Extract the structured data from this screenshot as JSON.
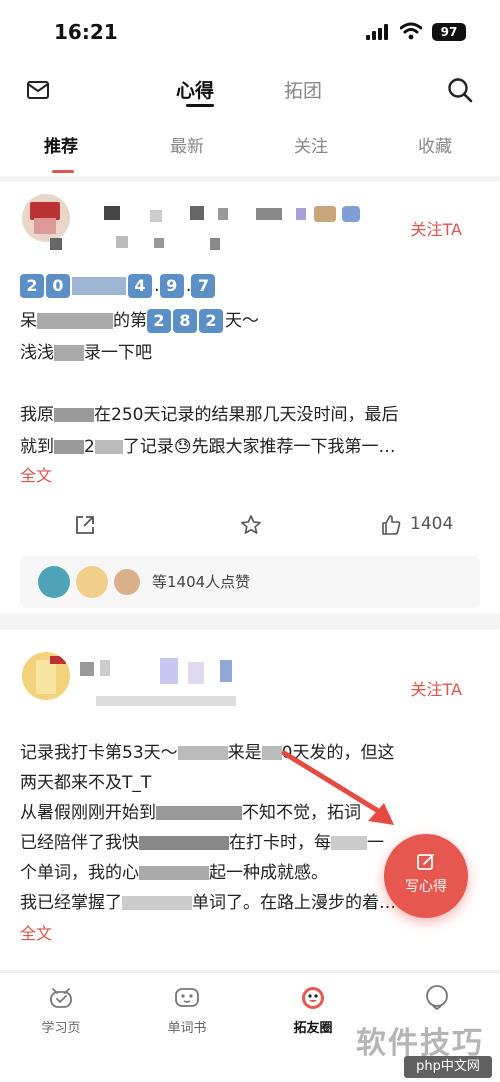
{
  "status_bar": {
    "time": "16:21",
    "battery": "97"
  },
  "header": {
    "tabs": [
      {
        "label": "心得",
        "active": true
      },
      {
        "label": "拓团",
        "active": false
      }
    ]
  },
  "subtabs": [
    {
      "label": "推荐",
      "active": true
    },
    {
      "label": "最新",
      "active": false
    },
    {
      "label": "关注",
      "active": false
    },
    {
      "label": "收藏",
      "active": false
    }
  ],
  "posts": [
    {
      "follow_label": "关注TA",
      "date_digits": [
        "2",
        "0",
        "4",
        "9",
        "7"
      ],
      "line2_prefix": "呆",
      "line2_mid": "的第",
      "line2_digits": [
        "2",
        "8",
        "2"
      ],
      "line2_suffix": "天～",
      "line3_a": "浅浅",
      "line3_b": "录一下吧",
      "body_line1_a": "我原",
      "body_line1_b": "在250天记录的结果那几天没时间，最后",
      "body_line2_a": "就到",
      "body_line2_b": "2",
      "body_line2_c": "了记录",
      "body_line2_emoji": "😓",
      "body_line2_d": "先跟大家推荐一下我第一…",
      "full_label": "全文",
      "like_count": "1404",
      "liked_summary": "等1404人点赞"
    },
    {
      "follow_label": "关注TA",
      "line1_a": "记录我打卡第53天～",
      "line1_b": "来是",
      "line1_c": "0天发的，但这",
      "line2_a": "两天都来不及",
      "line2_b": "T_T",
      "line3_a": "从暑假刚刚开始到",
      "line3_b": "不知不觉，拓词",
      "line4_a": "已经陪伴了我快",
      "line4_b": "在打卡时，每",
      "line4_c": "一",
      "line5_a": "个单词，我的心",
      "line5_b": "起一种成就感。",
      "line6_a": "我已经掌握了",
      "line6_b": "单词了。在路上漫步的着…",
      "full_label": "全文"
    }
  ],
  "fab": {
    "label": "写心得"
  },
  "bottom_nav": [
    {
      "label": "学习页",
      "icon": "study-icon"
    },
    {
      "label": "单词书",
      "icon": "wordbook-icon"
    },
    {
      "label": "拓友圈",
      "icon": "community-icon",
      "active": true
    },
    {
      "label": "",
      "icon": "profile-icon"
    }
  ],
  "watermark": {
    "text": "软件技巧",
    "site": "php中文网"
  },
  "colors": {
    "accent": "#e6574f",
    "digit_box": "#5b8fc6"
  }
}
